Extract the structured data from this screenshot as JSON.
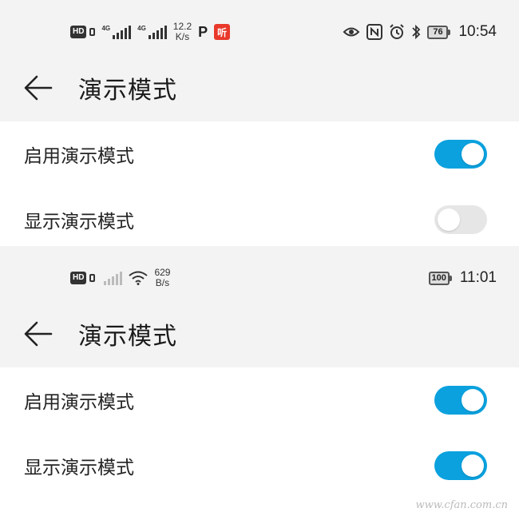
{
  "screens": [
    {
      "status": {
        "hd": "HD",
        "sim1_label": "4G",
        "sim2_label": "4G",
        "speed_value": "12.2",
        "speed_unit": "K/s",
        "p_app": "P",
        "ting_app": "听",
        "battery": "76",
        "time": "10:54",
        "icons": [
          "eye-comfort-icon",
          "nfc-icon",
          "alarm-icon",
          "bluetooth-icon"
        ]
      },
      "title": "演示模式",
      "settings": [
        {
          "label": "启用演示模式",
          "on": true
        },
        {
          "label": "显示演示模式",
          "on": false
        }
      ]
    },
    {
      "status": {
        "hd": "HD",
        "speed_value": "629",
        "speed_unit": "B/s",
        "battery": "100",
        "time": "11:01",
        "icons": [
          "wifi-icon"
        ]
      },
      "title": "演示模式",
      "settings": [
        {
          "label": "启用演示模式",
          "on": true
        },
        {
          "label": "显示演示模式",
          "on": true
        }
      ]
    }
  ],
  "watermark": "www.cfan.com.cn",
  "colors": {
    "switch_on": "#0aa1de",
    "switch_off": "#e6e6e6",
    "background": "#f3f3f3"
  }
}
